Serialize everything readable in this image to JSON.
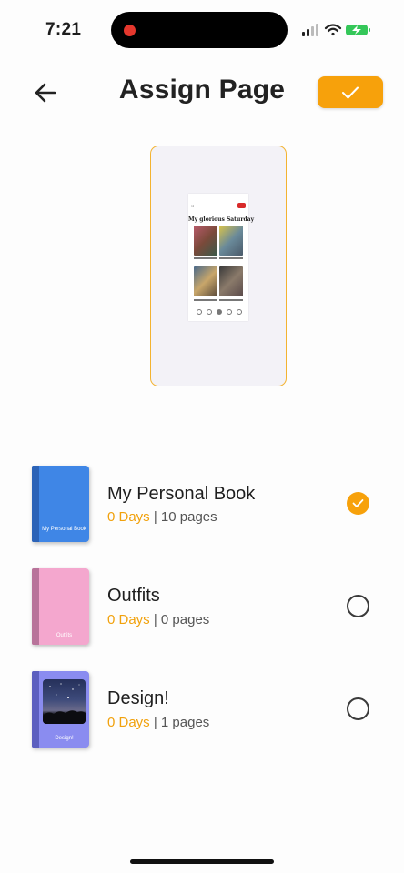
{
  "status": {
    "time": "7:21"
  },
  "header": {
    "title": "Assign Page"
  },
  "preview": {
    "page_title": "My glorious Saturday"
  },
  "books": [
    {
      "name": "My Personal Book",
      "days": "0 Days",
      "pages": "10 pages",
      "selected": true,
      "cover_text": "My Personal Book",
      "cover_color": "#3f86e6"
    },
    {
      "name": "Outfits",
      "days": "0 Days",
      "pages": "0 pages",
      "selected": false,
      "cover_text": "Outfits",
      "cover_color": "#f4a7ce"
    },
    {
      "name": "Design!",
      "days": "0 Days",
      "pages": "1 pages",
      "selected": false,
      "cover_text": "Design!",
      "cover_color": "#8a8cf0"
    }
  ],
  "separator": " | ",
  "colors": {
    "accent": "#f7a10b",
    "days": "#f1a10c"
  }
}
